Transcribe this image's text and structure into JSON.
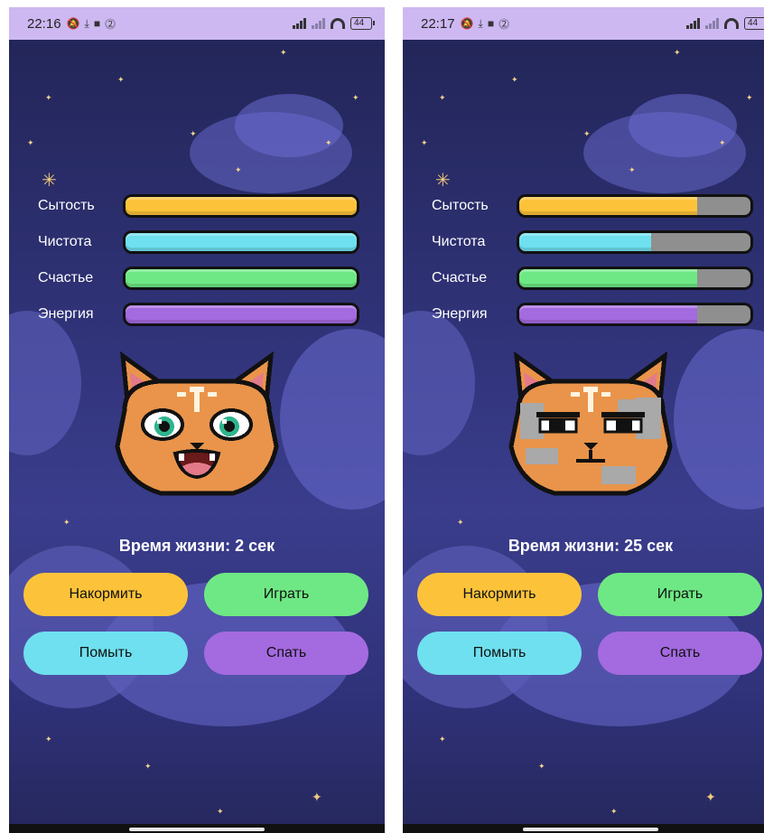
{
  "screens": [
    {
      "status": {
        "time": "22:16",
        "battery": "44"
      },
      "stats": [
        {
          "label": "Сытость",
          "level": 1.0,
          "color": "#fcc33a"
        },
        {
          "label": "Чистота",
          "level": 1.0,
          "color": "#6fe0ef"
        },
        {
          "label": "Счастье",
          "level": 1.0,
          "color": "#6ee884"
        },
        {
          "label": "Энергия",
          "level": 1.0,
          "color": "#a46ae0"
        }
      ],
      "cat": {
        "state": "happy",
        "dirty": false
      },
      "lifetime": "Время жизни: 2 сек",
      "buttons": {
        "feed": "Накормить",
        "play": "Играть",
        "wash": "Помыть",
        "sleep": "Спать"
      }
    },
    {
      "status": {
        "time": "22:17",
        "battery": "44"
      },
      "stats": [
        {
          "label": "Сытость",
          "level": 0.77,
          "color": "#fcc33a"
        },
        {
          "label": "Чистота",
          "level": 0.57,
          "color": "#6fe0ef"
        },
        {
          "label": "Счастье",
          "level": 0.77,
          "color": "#6ee884"
        },
        {
          "label": "Энергия",
          "level": 0.77,
          "color": "#a46ae0"
        }
      ],
      "cat": {
        "state": "grumpy",
        "dirty": true
      },
      "lifetime": "Время жизни: 25 сек",
      "buttons": {
        "feed": "Накормить",
        "play": "Играть",
        "wash": "Помыть",
        "sleep": "Спать"
      }
    }
  ],
  "colors": {
    "feed_button": "#fcc33a",
    "play_button": "#6ee884",
    "wash_button": "#6fe0ef",
    "sleep_button": "#a46ae0",
    "status_bar": "#cdb8f2",
    "empty_bar": "#8f8f8f"
  },
  "icons": [
    "mute-icon",
    "download-icon",
    "video-icon",
    "shield-icon",
    "signal-icon",
    "wifi-icon",
    "battery-icon",
    "star-icon",
    "cat-face-icon"
  ]
}
